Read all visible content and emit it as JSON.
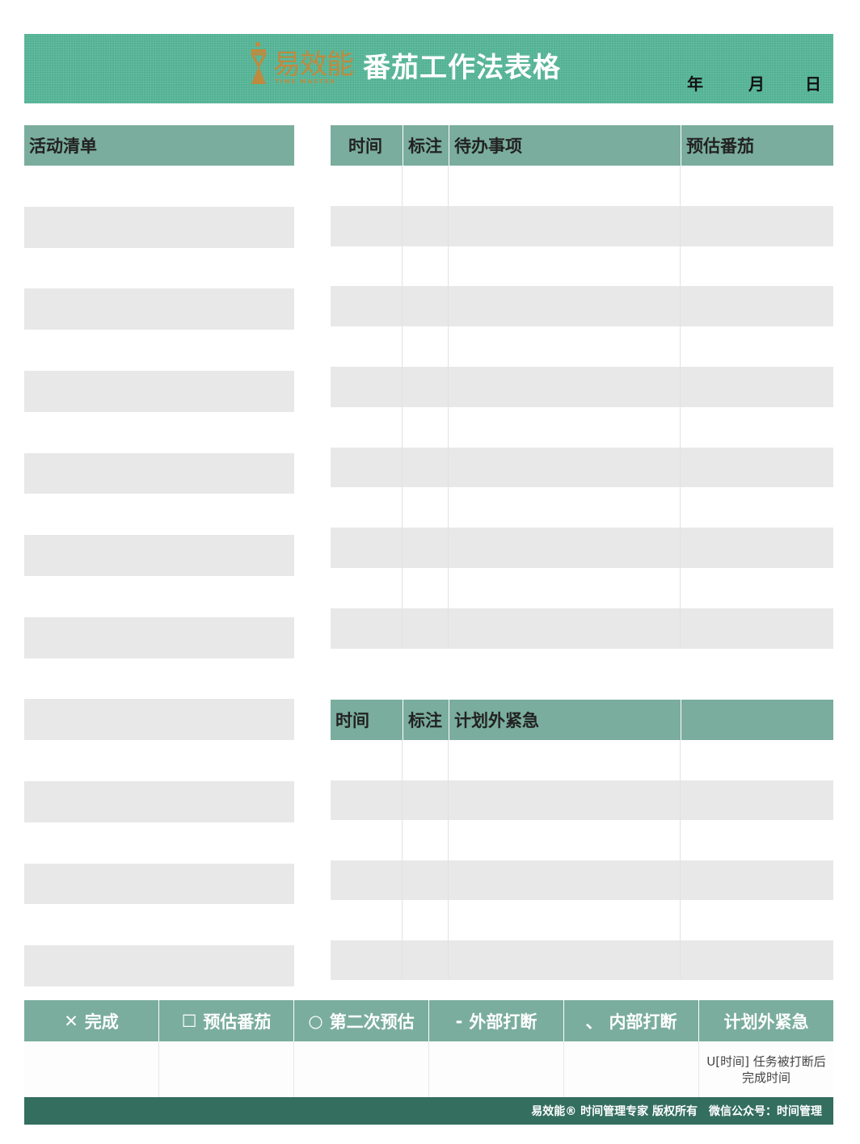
{
  "header": {
    "logo_text": "易效能",
    "logo_sub": "TIME MASTER",
    "title": "番茄工作法表格",
    "date": {
      "year": "年",
      "month": "月",
      "day": "日"
    }
  },
  "activity_list": {
    "header": "活动清单",
    "row_count": 20
  },
  "todo_table": {
    "headers": {
      "time": "时间",
      "mark": "标注",
      "task": "待办事项",
      "estimate": "预估番茄"
    },
    "row_count": 12
  },
  "urgent_table": {
    "headers": {
      "time": "时间",
      "mark": "标注",
      "task": "计划外紧急",
      "extra": ""
    },
    "row_count": 6
  },
  "legend": [
    {
      "symbol": "✕",
      "label": "完成"
    },
    {
      "symbol": "☐",
      "label": "预估番茄"
    },
    {
      "symbol": "○",
      "label": "第二次预估"
    },
    {
      "symbol": "-",
      "label": "外部打断"
    },
    {
      "symbol": "、",
      "label": "内部打断"
    },
    {
      "symbol": "",
      "label": "计划外紧急"
    }
  ],
  "legend_note": "U[时间] 任务被打断后完成时间",
  "legend_note_lines": [
    "U[时间] 任务被打断后",
    "完成时间"
  ],
  "footer": {
    "left": "易效能® 时间管理专家 版权所有",
    "right": "微信公众号：时间管理"
  },
  "colors": {
    "banner": "#52b293",
    "header_cell": "#7aad9d",
    "stripe": "#e8e8e8",
    "footer": "#346e5f",
    "logo": "#c08a3e"
  }
}
